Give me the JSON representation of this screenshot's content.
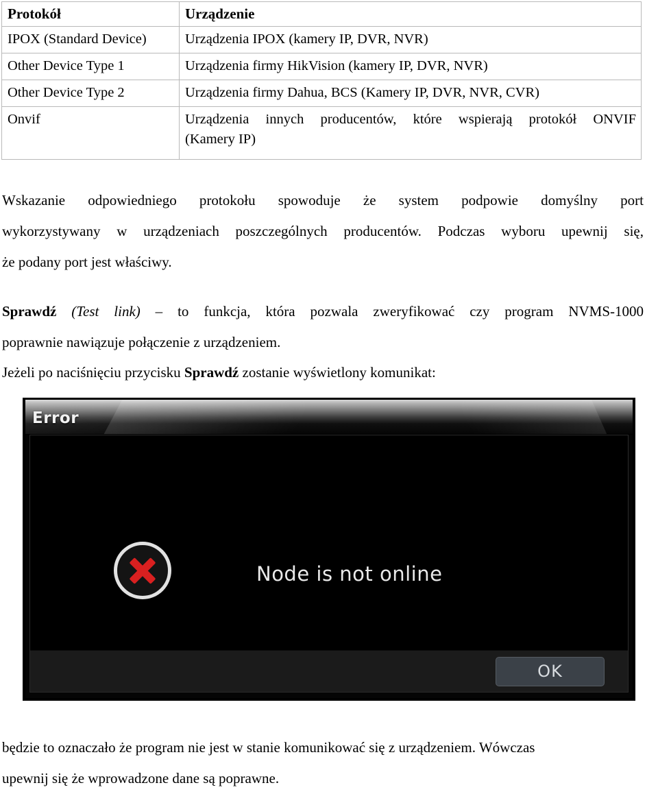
{
  "table": {
    "headers": [
      "Protokół",
      "Urządzenie"
    ],
    "rows": [
      {
        "protocol": "IPOX (Standard Device)",
        "device": "Urządzenia IPOX (kamery IP, DVR, NVR)"
      },
      {
        "protocol": "Other Device Type 1",
        "device": "Urządzenia firmy HikVision (kamery IP, DVR, NVR)"
      },
      {
        "protocol": "Other Device Type 2",
        "device": "Urządzenia firmy Dahua, BCS (Kamery IP, DVR, NVR, CVR)"
      },
      {
        "protocol": "Onvif",
        "device_line1": "Urządzenia innych producentów, które wspierają protokół ONVIF",
        "device_line2": "(Kamery IP)"
      }
    ]
  },
  "paragraphs": {
    "p1": {
      "line1": "Wskazanie odpowiedniego protokołu spowoduje że system podpowie domyślny port",
      "line2": "wykorzystywany w urządzeniach poszczególnych producentów. Podczas wyboru upewnij się,",
      "line3": "że podany port jest właściwy."
    },
    "p2": {
      "bold_lead": "Sprawdź",
      "italic_paren_open": "(",
      "italic_label": "Test link",
      "italic_paren_close": ")",
      "dash": " – ",
      "rest_line1": " to funkcja, która pozwala zweryfikować czy program NVMS-1000",
      "line2": "poprawnie nawiązuje połączenie z urządzeniem."
    },
    "p3": {
      "before": "Jeżeli po naciśnięciu przycisku ",
      "bold": "Sprawdź",
      "after": " zostanie wyświetlony komunikat:"
    },
    "p4": {
      "line1": "będzie to oznaczało że program nie jest w stanie komunikować się z urządzeniem. Wówczas",
      "line2": "upewnij się że wprowadzone dane są poprawne."
    }
  },
  "dialog": {
    "title": "Error",
    "message": "Node is not online",
    "ok_label": "OK",
    "icon": "error-x-circle-icon",
    "colors": {
      "error_red": "#d92020",
      "body_background": "#000000",
      "footer_background": "#1b1b1b",
      "button_background": "#3b4148",
      "title_text": "#f2f2f2"
    }
  }
}
